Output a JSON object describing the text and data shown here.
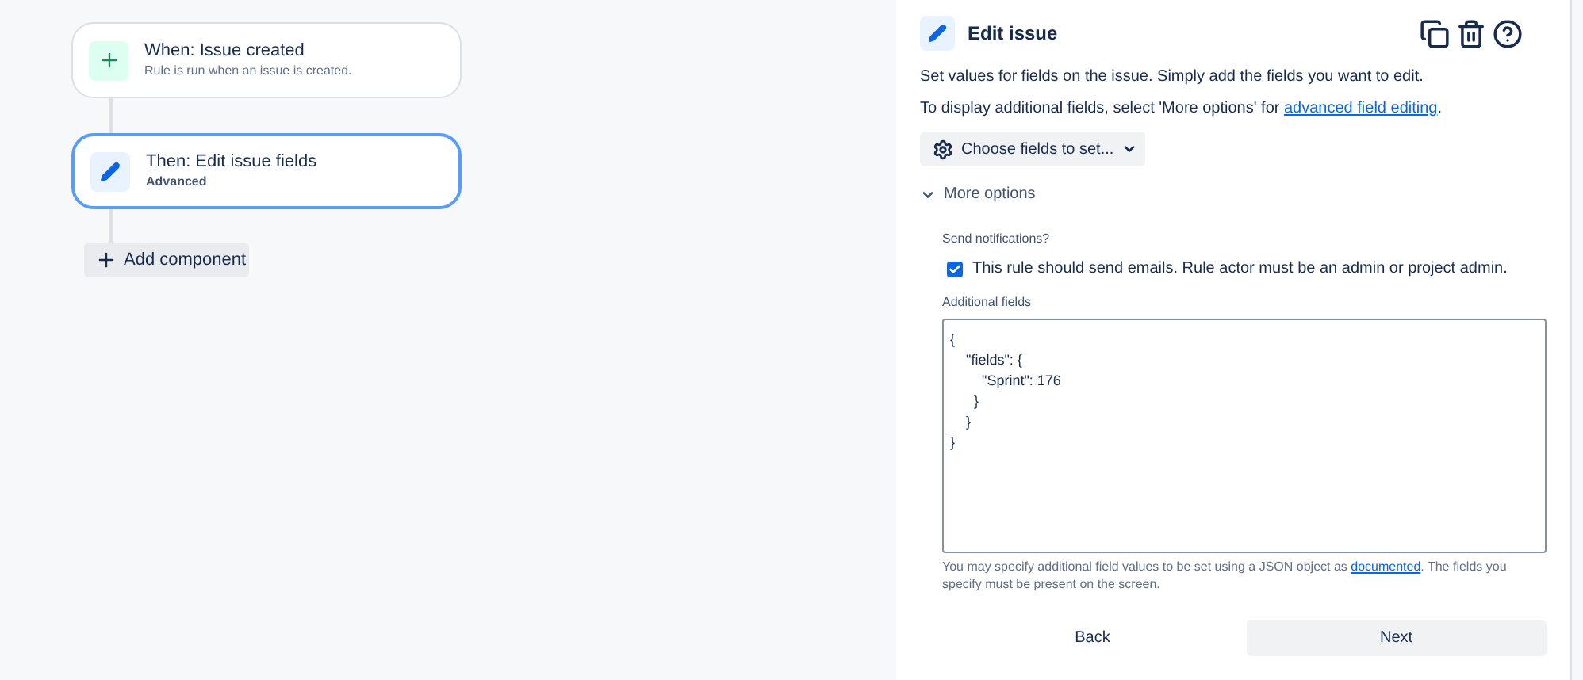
{
  "flow": {
    "nodes": [
      {
        "kind": "trigger",
        "title": "When: Issue created",
        "subtitle": "Rule is run when an issue is created.",
        "selected": false
      },
      {
        "kind": "action",
        "title": "Then: Edit issue fields",
        "subtitle": "Advanced",
        "selected": true
      }
    ],
    "add_button": "Add component"
  },
  "panel": {
    "title": "Edit issue",
    "description": "Set values for fields on the issue. Simply add the fields you want to edit.",
    "hint": {
      "before": "To display additional fields, select 'More options' for ",
      "link": "advanced field editing",
      "after": "."
    },
    "choose_button": "Choose fields to set...",
    "more_options": {
      "label": "More options",
      "expanded": true
    },
    "notifications": {
      "label": "Send notifications?",
      "checkbox_label": "This rule should send emails. Rule actor must be an admin or project admin.",
      "checked": true
    },
    "additional_fields": {
      "label": "Additional fields",
      "value": "{\n    \"fields\": {\n        \"Sprint\": 176\n      }\n    }\n}",
      "help": {
        "before": "You may specify additional field values to be set using a JSON object as ",
        "link": "documented",
        "after": ". The fields you specify must be present on the screen."
      }
    },
    "buttons": [
      {
        "label": "Back",
        "kind": "subtle"
      },
      {
        "label": "Next",
        "kind": "default"
      }
    ]
  }
}
